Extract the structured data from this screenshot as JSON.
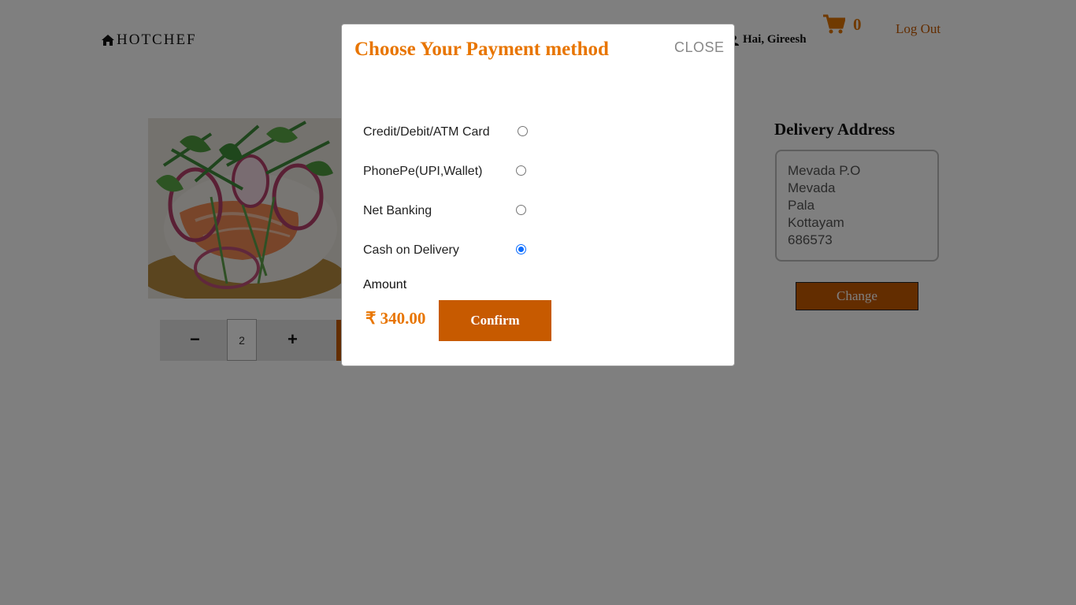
{
  "header": {
    "brand": "HOTCHEF",
    "greeting": "Hai, Gireesh",
    "cart_count": "0",
    "logout_label": "Log Out"
  },
  "product": {
    "image_icon": "salmon-dish-photo",
    "quantity": "2",
    "minus_label": "−",
    "plus_label": "+"
  },
  "delivery": {
    "title": "Delivery Address",
    "address_lines": [
      "Mevada P.O",
      "Mevada",
      "Pala",
      "Kottayam",
      "686573"
    ],
    "change_label": "Change"
  },
  "modal": {
    "title": "Choose Your Payment method",
    "close_label": "CLOSE",
    "options": [
      {
        "label": "Credit/Debit/ATM Card",
        "selected": false
      },
      {
        "label": "PhonePe(UPI,Wallet)",
        "selected": false
      },
      {
        "label": "Net Banking",
        "selected": false
      },
      {
        "label": "Cash on Delivery",
        "selected": true
      }
    ],
    "amount_label": "Amount",
    "amount_value": "₹ 340.00",
    "confirm_label": "Confirm"
  },
  "colors": {
    "accent": "#e87500",
    "button": "#c75a00",
    "radio_selected": "#0a6cff"
  }
}
